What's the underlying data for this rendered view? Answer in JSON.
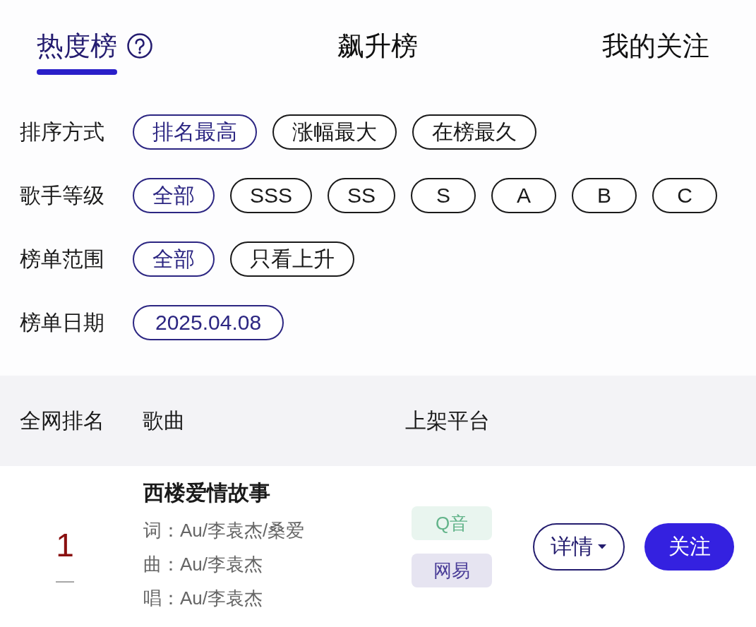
{
  "tabs": [
    {
      "label": "热度榜",
      "selected": true,
      "help": true
    },
    {
      "label": "飙升榜",
      "selected": false,
      "help": false
    },
    {
      "label": "我的关注",
      "selected": false,
      "help": false
    }
  ],
  "filters": [
    {
      "kind": "choice",
      "label": "排序方式",
      "options": [
        {
          "label": "排名最高",
          "selected": true
        },
        {
          "label": "涨幅最大",
          "selected": false
        },
        {
          "label": "在榜最久",
          "selected": false
        }
      ]
    },
    {
      "kind": "choice",
      "label": "歌手等级",
      "options": [
        {
          "label": "全部",
          "selected": true
        },
        {
          "label": "SSS",
          "selected": false
        },
        {
          "label": "SS",
          "selected": false
        },
        {
          "label": "S",
          "selected": false
        },
        {
          "label": "A",
          "selected": false
        },
        {
          "label": "B",
          "selected": false
        },
        {
          "label": "C",
          "selected": false
        }
      ]
    },
    {
      "kind": "choice",
      "label": "榜单范围",
      "options": [
        {
          "label": "全部",
          "selected": true
        },
        {
          "label": "只看上升",
          "selected": false
        }
      ]
    },
    {
      "kind": "date",
      "label": "榜单日期",
      "value": "2025.04.08"
    }
  ],
  "table": {
    "columns": [
      "全网排名",
      "歌曲",
      "上架平台"
    ],
    "rows": [
      {
        "rank": "1",
        "change": "—",
        "title": "西楼爱情故事",
        "credits": [
          "词：Au/李袁杰/桑爱",
          "曲：Au/李袁杰",
          "唱：Au/李袁杰"
        ],
        "platforms": [
          {
            "label": "Q音",
            "color": "#63b48a"
          },
          {
            "label": "网易",
            "color": "#4a3d98"
          }
        ],
        "actions": [
          {
            "label": "详情",
            "kind": "menu"
          },
          {
            "label": "关注",
            "kind": "primary"
          }
        ]
      }
    ]
  }
}
